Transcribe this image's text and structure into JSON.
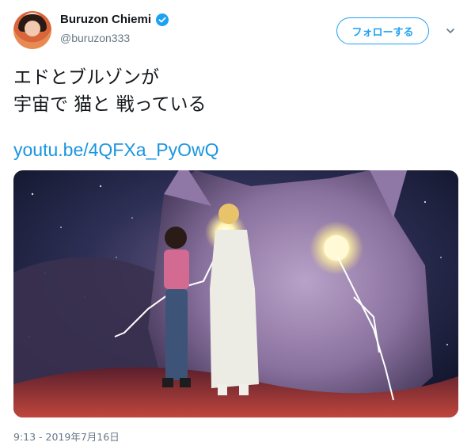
{
  "user": {
    "display_name": "Buruzon Chiemi",
    "handle": "@buruzon333",
    "verified": true
  },
  "follow_button": {
    "label": "フォローする"
  },
  "tweet": {
    "text_line1": "エドとブルゾンが",
    "text_line2": "宇宙で 猫と 戦っている",
    "link": "youtu.be/4QFXa_PyOwQ",
    "timestamp": "9:13 - 2019年7月16日"
  },
  "colors": {
    "accent": "#1da1f2",
    "link": "#1b95e0",
    "secondary_text": "#657786"
  },
  "icons": {
    "verified": "verified-badge-icon",
    "caret": "chevron-down-icon"
  }
}
